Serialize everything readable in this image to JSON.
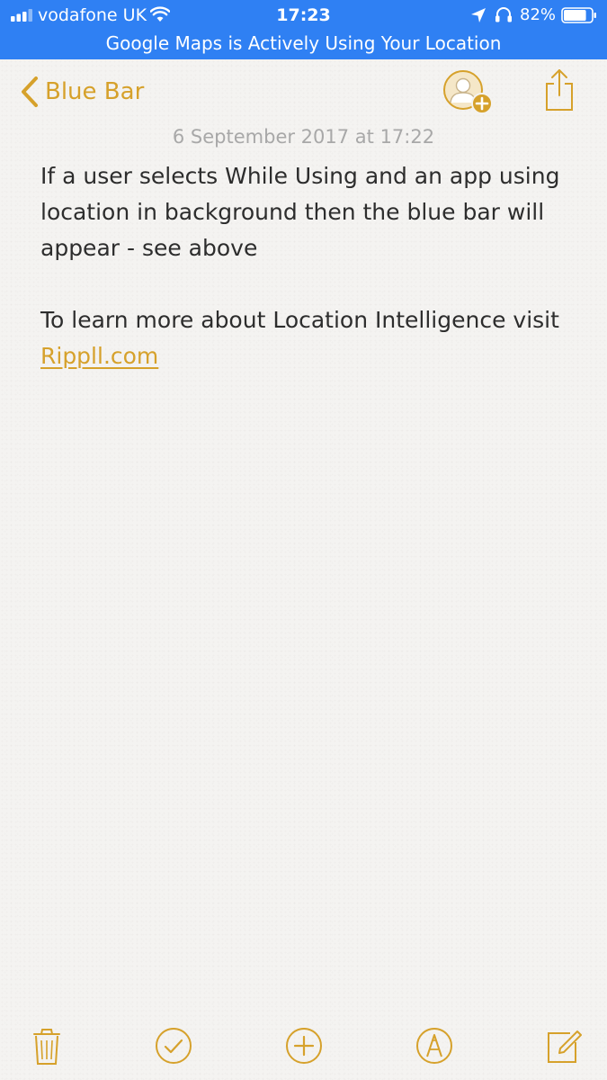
{
  "status_bar": {
    "carrier": "vodafone UK",
    "time": "17:23",
    "battery_percent": "82%",
    "battery_level": 0.82,
    "background_color": "#2f80f3",
    "icons": [
      "signal-icon",
      "wifi-icon",
      "location-arrow-icon",
      "headphones-icon",
      "battery-icon"
    ]
  },
  "location_banner": {
    "text": "Google Maps is Actively Using Your Location"
  },
  "nav": {
    "back_label": "Blue Bar",
    "accent_color": "#d6a12b",
    "icons": [
      "back-chevron-icon",
      "add-person-icon",
      "share-icon"
    ]
  },
  "note": {
    "date": "6 September 2017 at 17:22",
    "paragraph_1": "If a user selects While Using and an app using location in background then the blue bar will appear - see above",
    "paragraph_2_text": "To learn more about Location Intelligence visit",
    "link_text": "Rippll.com"
  },
  "toolbar": {
    "icons": [
      "trash-icon",
      "checklist-icon",
      "add-icon",
      "markup-icon",
      "compose-icon"
    ]
  }
}
